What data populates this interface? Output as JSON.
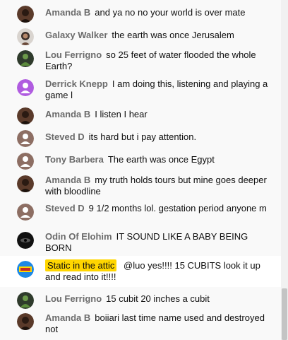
{
  "messages": [
    {
      "author": "Amanda B",
      "text": "and ya no no your world is over mate",
      "avatar_icon": "dark-portrait-avatar",
      "avatar_color": "#5a3a2a"
    },
    {
      "author": "Galaxy Walker",
      "text": "the earth was once Jerusalem",
      "avatar_icon": "woman-portrait-avatar",
      "avatar_color": "#3b2f2a"
    },
    {
      "author": "Lou Ferrigno",
      "text": "so 25 feet of water flooded the whole Earth?",
      "avatar_icon": "green-figure-avatar",
      "avatar_color": "#3d5a3a"
    },
    {
      "author": "Derrick Knepp",
      "text": "I am doing this, listening and playing a game l",
      "avatar_icon": "default-person-avatar",
      "avatar_color": "#b05ce0"
    },
    {
      "author": "Amanda B",
      "text": "I listen I hear",
      "avatar_icon": "dark-portrait-avatar",
      "avatar_color": "#5a3a2a"
    },
    {
      "author": "Steved D",
      "text": "its hard but i pay attention.",
      "avatar_icon": "default-person-avatar",
      "avatar_color": "#8d6e63"
    },
    {
      "author": "Tony Barbera",
      "text": "The earth was once Egypt",
      "avatar_icon": "default-person-avatar",
      "avatar_color": "#8d6e63"
    },
    {
      "author": "Amanda B",
      "text": "my truth holds tours but mine goes deeper with bloodline",
      "avatar_icon": "dark-portrait-avatar",
      "avatar_color": "#5a3a2a"
    },
    {
      "author": "Steved D",
      "text": "9 1/2 months lol. gestation period anyone m",
      "avatar_icon": "default-person-avatar",
      "avatar_color": "#8d6e63"
    },
    {
      "author": "Odin Of Elohim",
      "text": "IT SOUND LIKE A BABY BEING BORN",
      "avatar_icon": "dark-eye-avatar",
      "avatar_color": "#111111"
    },
    {
      "author": "Static in the attic",
      "text": "@luo yes!!!! 15 CUBITS look it up and read into it!!!!",
      "avatar_icon": "static-attic-logo-avatar",
      "avatar_color": "#1e88e5",
      "highlight": true
    },
    {
      "author": "Lou Ferrigno",
      "text": "15 cubit 20 inches a cubit",
      "avatar_icon": "green-figure-avatar",
      "avatar_color": "#3d5a3a"
    },
    {
      "author": "Amanda B",
      "text": "boiiari last time name used and destroyed not",
      "avatar_icon": "dark-portrait-avatar",
      "avatar_color": "#5a3a2a"
    }
  ],
  "colors": {
    "author_text": "#6b6b6b",
    "message_text": "#0f0f0f",
    "highlight_chip": "#ffd600",
    "background": "#f9f9f9"
  }
}
